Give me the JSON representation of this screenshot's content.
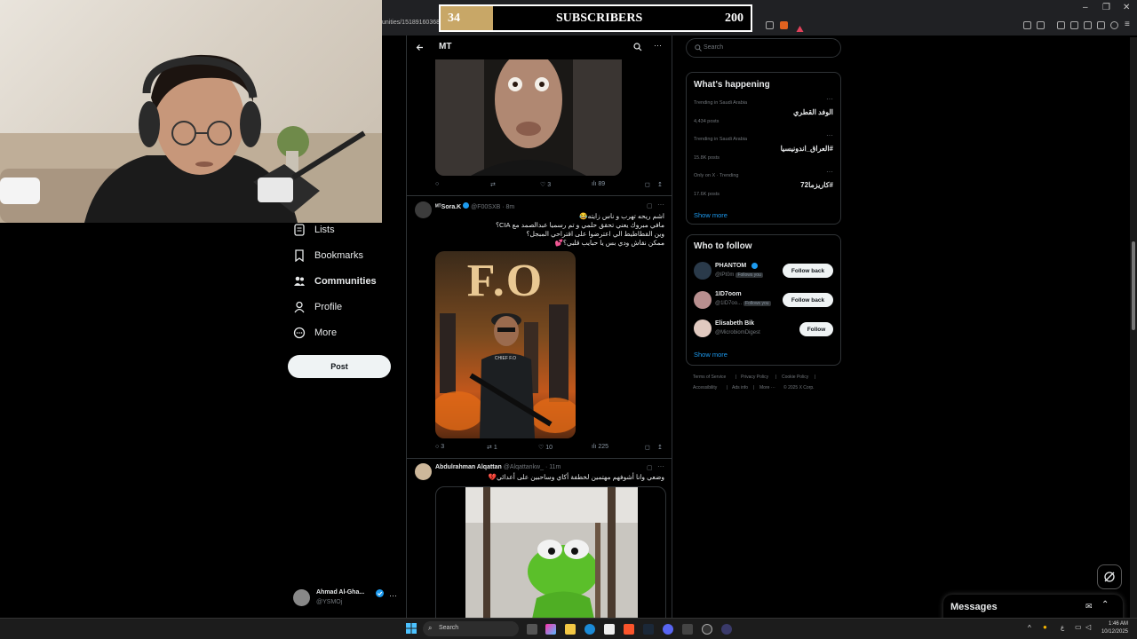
{
  "browser": {
    "url_fragment": "unities/15189160368",
    "window_controls": [
      "–",
      "❐",
      "✕"
    ]
  },
  "subscribers": {
    "current": "34",
    "label": "SUBSCRIBERS",
    "goal": "200",
    "progress": 0.17,
    "fill_color": "#c8a767"
  },
  "nav": {
    "items": [
      {
        "label": "Lists",
        "icon": "list-icon"
      },
      {
        "label": "Bookmarks",
        "icon": "bookmark-icon"
      },
      {
        "label": "Communities",
        "icon": "communities-icon",
        "active": true
      },
      {
        "label": "Profile",
        "icon": "profile-icon"
      },
      {
        "label": "More",
        "icon": "more-circle-icon"
      }
    ],
    "post_label": "Post",
    "account": {
      "name": "Ahmad Al-Gha...",
      "handle": "@YSMOj"
    }
  },
  "timeline": {
    "header_title": "MT",
    "tweet0": {
      "replies": "",
      "retweets": "",
      "likes": "3",
      "views": "89"
    },
    "tweet1": {
      "name": "ᴹᵀSora.K",
      "handle": "@F00SXB",
      "time": "· 8m",
      "lines": [
        "اشم ريحه تهرب و ناس زايته😂",
        "مافي مبروك يعني تحقق حلمي و تم رسميا عبدالصمد مع CIA؟",
        "وين القطاطيط الي اعترضوا على اقتراحي المبجل؟",
        "ممكن نقاش ودي بس يا حبايب قلبي؟💕"
      ],
      "image_text": "F.O",
      "badge_text": "CHIEF F.O",
      "replies": "3",
      "retweets": "1",
      "likes": "10",
      "views": "225"
    },
    "tweet2": {
      "name": "Abdulrahman Alqattan",
      "handle": "@Alqattankw_",
      "time": "· 11m",
      "line": "وضعي وانا أشوفهم مهتمين لخطفة أكاي وساحبين على أعدائي💔"
    }
  },
  "sidebar": {
    "search_placeholder": "Search",
    "happening": {
      "title": "What's happening",
      "trends": [
        {
          "meta": "Trending in Saudi Arabia",
          "title": "الوفد القطري",
          "posts": "4,434 posts"
        },
        {
          "meta": "Trending in Saudi Arabia",
          "title": "#العراق_اندونيسيا",
          "posts": "15.8K posts"
        },
        {
          "meta": "Only on X · Trending",
          "title": "#كاريزما72",
          "posts": "17.6K posts"
        }
      ],
      "show_more": "Show more"
    },
    "who_to_follow": {
      "title": "Who to follow",
      "users": [
        {
          "name": "PHANTOM",
          "handle": "@lPt0m",
          "follows_you": "Follows you",
          "button": "Follow back",
          "verified": true
        },
        {
          "name": "1ID7oom",
          "handle": "@1lD7oo...",
          "follows_you": "Follows you",
          "button": "Follow back",
          "verified": false
        },
        {
          "name": "Elisabeth Bik",
          "handle": "@MicrobiomDigest",
          "follows_you": "",
          "button": "Follow",
          "verified": false
        }
      ],
      "show_more": "Show more"
    },
    "footer": [
      "Terms of Service",
      "|",
      "Privacy Policy",
      "|",
      "Cookie Policy",
      "|",
      "Accessibility",
      "|",
      "Ads info",
      "|",
      "More ···",
      "© 2025 X Corp."
    ]
  },
  "messages": {
    "title": "Messages"
  },
  "taskbar": {
    "search_placeholder": "Search",
    "time": "1:46 AM",
    "date": "10/12/2025",
    "lang": "ع"
  },
  "colors": {
    "accent": "#1d9bf0",
    "background": "#000000",
    "border": "#2f3336"
  }
}
